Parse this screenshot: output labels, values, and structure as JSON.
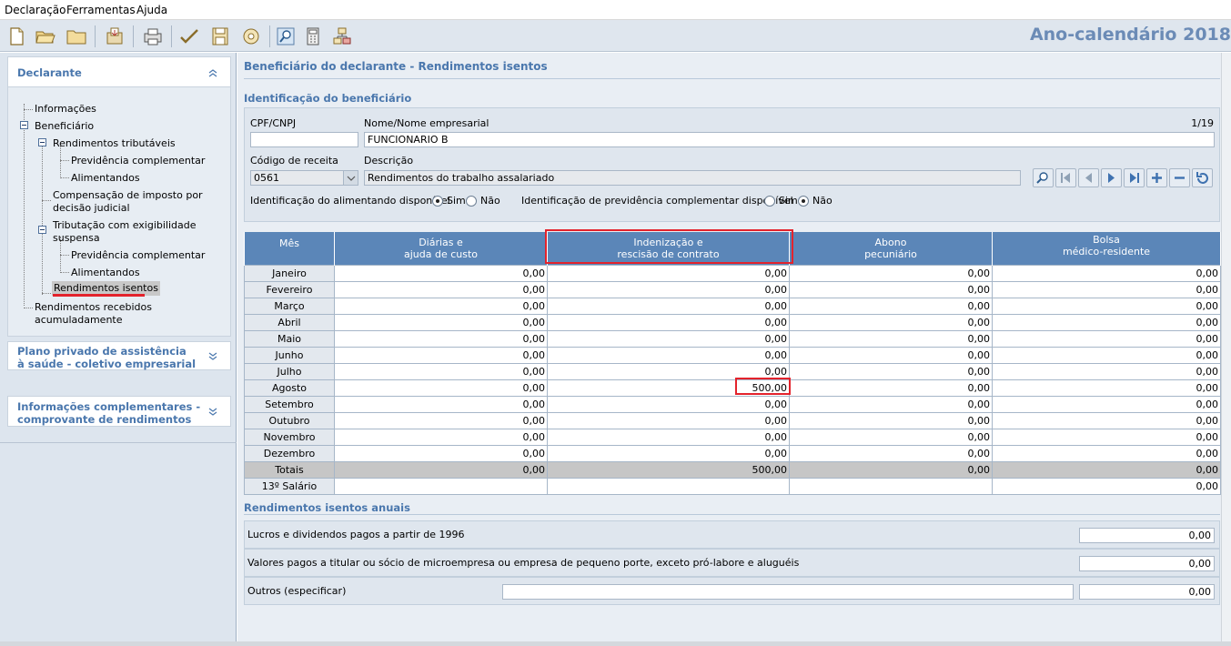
{
  "menu": [
    "Declaração",
    "Ferramentas",
    "Ajuda"
  ],
  "toolbar": {
    "icons": [
      "new-file-icon",
      "open-folder-icon",
      "folder-icon",
      "export-icon",
      "print-icon",
      "check-icon",
      "save-icon",
      "recovery-icon",
      "search-icon",
      "calculator-icon",
      "network-icon"
    ],
    "year_label": "Ano-calendário 2018"
  },
  "sidebar": {
    "declarante": {
      "header": "Declarante",
      "items": {
        "informacoes": "Informações",
        "beneficiario": "Beneficiário",
        "rend_tributaveis": "Rendimentos tributáveis",
        "prev_comp_1": "Previdência complementar",
        "alimentandos_1": "Alimentandos",
        "compensacao_1": "Compensação de imposto por",
        "compensacao_2": "decisão judicial",
        "tributacao_1": "Tributação com exigibilidade",
        "tributacao_2": "suspensa",
        "prev_comp_2": "Previdência complementar",
        "alimentandos_2": "Alimentandos",
        "rend_isentos": "Rendimentos isentos",
        "rra_1": "Rendimentos recebidos",
        "rra_2": "acumuladamente"
      }
    },
    "plano_privado": {
      "line1": "Plano privado de assistência",
      "line2": "à saúde - coletivo empresarial"
    },
    "info_compl": {
      "line1": "Informações complementares -",
      "line2": "comprovante de rendimentos"
    }
  },
  "main": {
    "title": "Beneficiário do declarante - Rendimentos isentos",
    "id_title": "Identificação do beneficiário",
    "cpf_label": "CPF/CNPJ",
    "cpf_value": "",
    "nome_label": "Nome/Nome empresarial",
    "nome_value": "FUNCIONARIO B",
    "counter": "1/19",
    "codigo_label": "Código de receita",
    "codigo_value": "0561",
    "descricao_label": "Descrição",
    "descricao_value": "Rendimentos do trabalho assalariado",
    "alimentando_label": "Identificação do alimentando disponível",
    "previdencia_label": "Identificação de previdência complementar disponível",
    "sim": "Sim",
    "nao": "Não",
    "alimentando_selected": "Sim",
    "previdencia_selected": "Não"
  },
  "table": {
    "headers": [
      {
        "l1": "Mês",
        "l2": ""
      },
      {
        "l1": "Diárias e",
        "l2": "ajuda de custo"
      },
      {
        "l1": "Indenização e",
        "l2": "rescisão de contrato"
      },
      {
        "l1": "Abono",
        "l2": "pecuniário"
      },
      {
        "l1": "Bolsa",
        "l2": "médico-residente"
      }
    ],
    "rows": [
      {
        "mes": "Janeiro",
        "v": [
          "0,00",
          "0,00",
          "0,00",
          "0,00"
        ]
      },
      {
        "mes": "Fevereiro",
        "v": [
          "0,00",
          "0,00",
          "0,00",
          "0,00"
        ]
      },
      {
        "mes": "Março",
        "v": [
          "0,00",
          "0,00",
          "0,00",
          "0,00"
        ]
      },
      {
        "mes": "Abril",
        "v": [
          "0,00",
          "0,00",
          "0,00",
          "0,00"
        ]
      },
      {
        "mes": "Maio",
        "v": [
          "0,00",
          "0,00",
          "0,00",
          "0,00"
        ]
      },
      {
        "mes": "Junho",
        "v": [
          "0,00",
          "0,00",
          "0,00",
          "0,00"
        ]
      },
      {
        "mes": "Julho",
        "v": [
          "0,00",
          "0,00",
          "0,00",
          "0,00"
        ]
      },
      {
        "mes": "Agosto",
        "v": [
          "0,00",
          "500,00",
          "0,00",
          "0,00"
        ]
      },
      {
        "mes": "Setembro",
        "v": [
          "0,00",
          "0,00",
          "0,00",
          "0,00"
        ]
      },
      {
        "mes": "Outubro",
        "v": [
          "0,00",
          "0,00",
          "0,00",
          "0,00"
        ]
      },
      {
        "mes": "Novembro",
        "v": [
          "0,00",
          "0,00",
          "0,00",
          "0,00"
        ]
      },
      {
        "mes": "Dezembro",
        "v": [
          "0,00",
          "0,00",
          "0,00",
          "0,00"
        ]
      }
    ],
    "totals": {
      "mes": "Totais",
      "v": [
        "0,00",
        "500,00",
        "0,00",
        "0,00"
      ]
    },
    "decimo": {
      "mes": "13º Salário",
      "v": [
        "",
        "",
        "",
        "0,00"
      ]
    }
  },
  "annual": {
    "title": "Rendimentos isentos anuais",
    "lucros_label": "Lucros e dividendos pagos a partir de 1996",
    "lucros_value": "0,00",
    "valores_label": "Valores pagos a titular ou sócio de microempresa ou empresa de pequeno porte, exceto pró-labore e aluguéis",
    "valores_value": "0,00",
    "outros_label": "Outros (especificar)",
    "outros_text": "",
    "outros_value": "0,00"
  }
}
